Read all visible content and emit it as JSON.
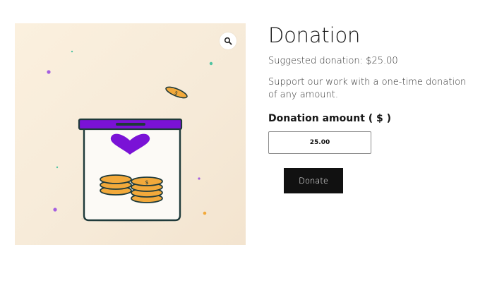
{
  "product": {
    "title": "Donation",
    "price_text": "Suggested donation: $25.00",
    "description": "Support our work with a one-time donation of any amount.",
    "image_alt": "Donation jar with coins and heart"
  },
  "form": {
    "amount_label": "Donation amount ( $ )",
    "amount_value": "25.00",
    "submit_label": "Donate"
  },
  "gallery": {
    "zoom_icon": "magnifier-icon"
  },
  "colors": {
    "jar_lid": "#7a12d6",
    "heart": "#7a12d6",
    "coin": "#f2a93b",
    "jar_outline": "#1f3a3a",
    "button_bg": "#111111",
    "image_bg": "#f8ecdb"
  }
}
